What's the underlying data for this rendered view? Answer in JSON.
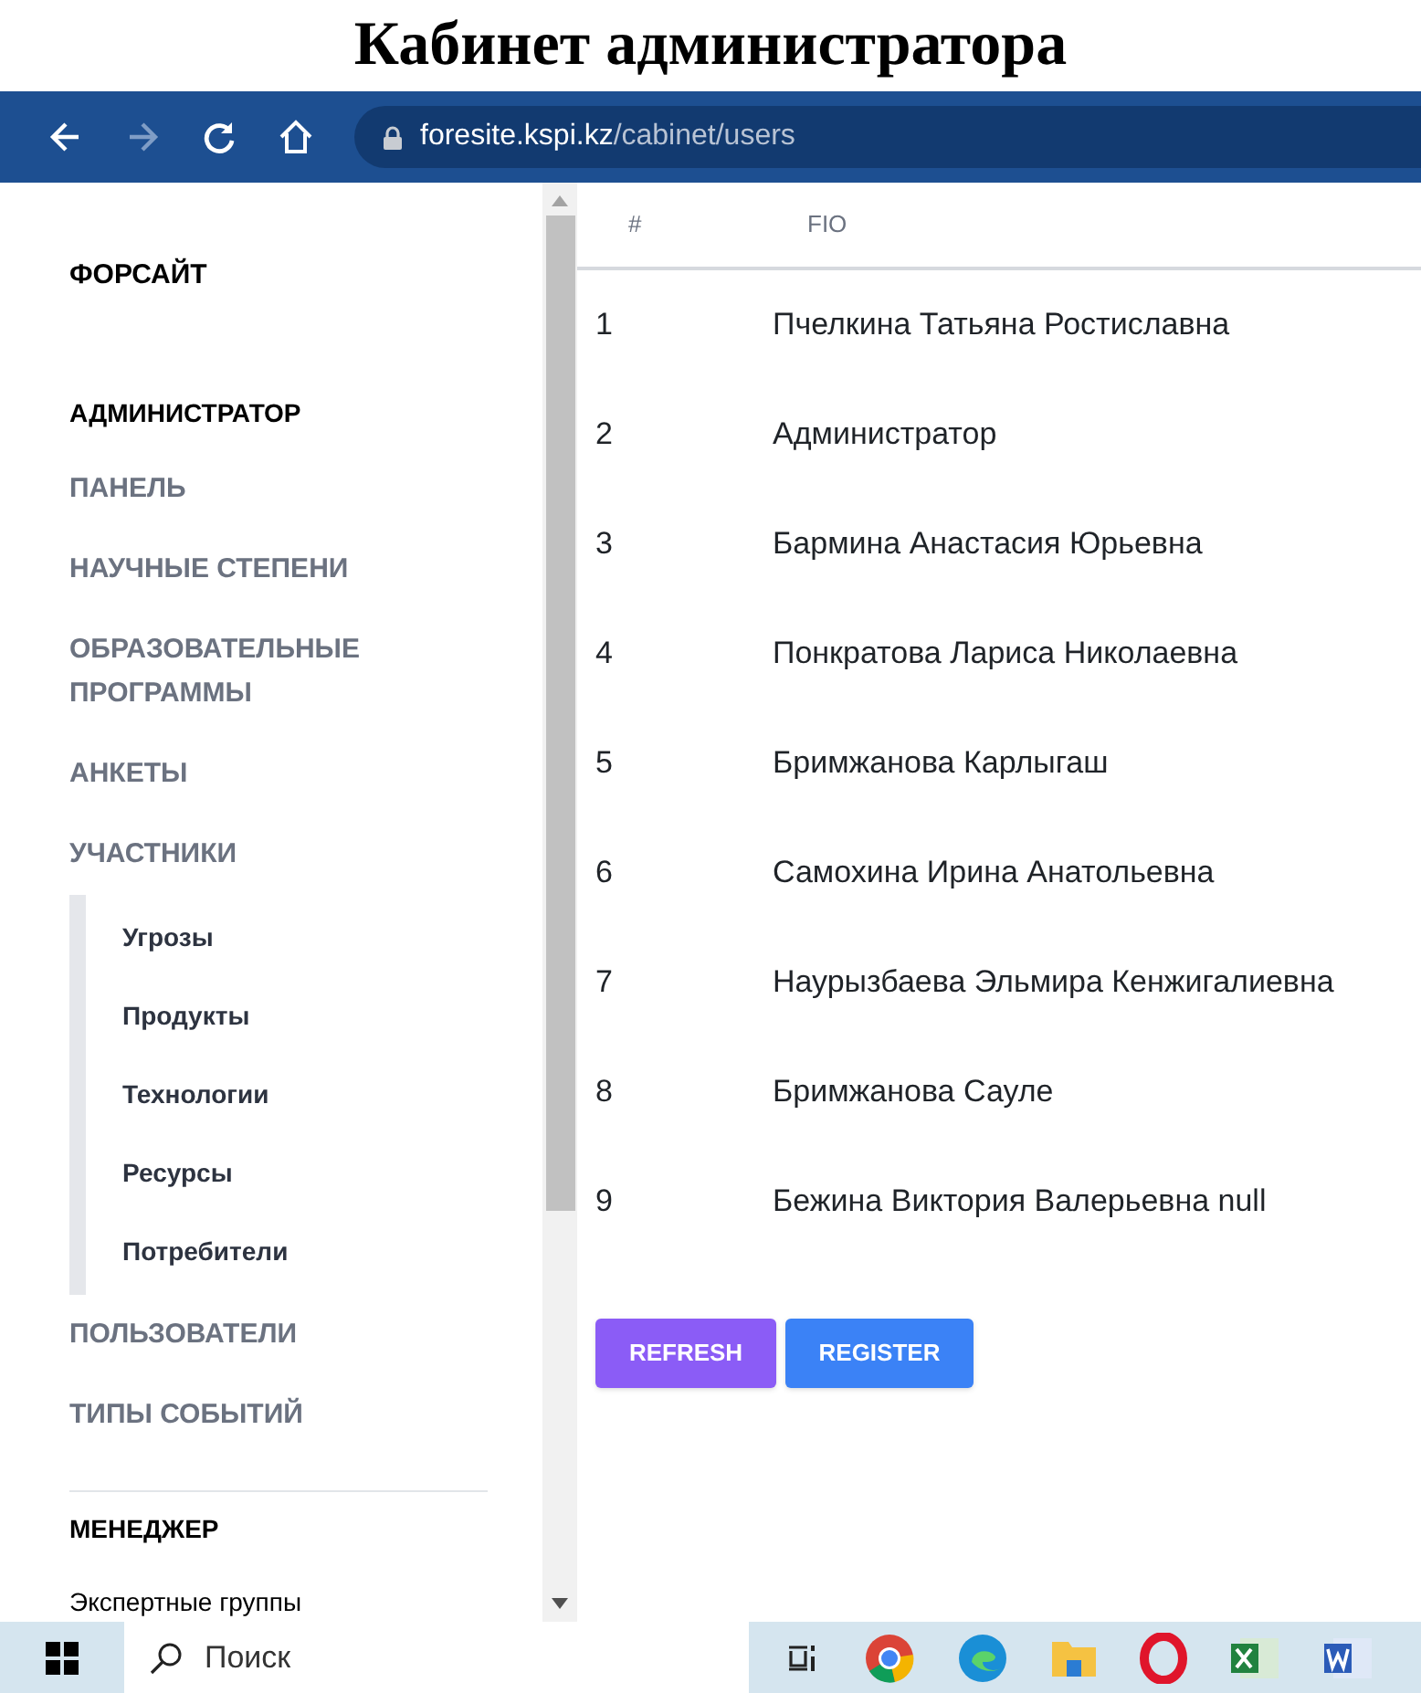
{
  "caption": "Кабинет администратора",
  "browser": {
    "url_host": "foresite.kspi.kz",
    "url_path": "/cabinet/users",
    "forward_disabled": true
  },
  "sidebar": {
    "brand": "ФОРСАЙТ",
    "sections": [
      {
        "title": "АДМИНИСТРАТОР",
        "items": [
          {
            "label": "ПАНЕЛЬ"
          },
          {
            "label": "НАУЧНЫЕ СТЕПЕНИ"
          },
          {
            "label": "ОБРАЗОВАТЕЛЬНЫЕ ПРОГРАММЫ"
          },
          {
            "label": "АНКЕТЫ"
          },
          {
            "label": "УЧАСТНИКИ",
            "expanded": true,
            "children": [
              {
                "label": "Угрозы"
              },
              {
                "label": "Продукты"
              },
              {
                "label": "Технологии"
              },
              {
                "label": "Ресурсы"
              },
              {
                "label": "Потребители"
              }
            ]
          },
          {
            "label": "ПОЛЬЗОВАТЕЛИ"
          },
          {
            "label": "ТИПЫ СОБЫТИЙ"
          }
        ]
      },
      {
        "title": "МЕНЕДЖЕР",
        "items": [
          {
            "label": "Экспертные группы",
            "kind": "plain"
          }
        ]
      }
    ]
  },
  "table": {
    "columns": [
      "#",
      "FIO"
    ],
    "rows": [
      [
        "1",
        "Пчелкина Татьяна Ростиславна"
      ],
      [
        "2",
        "Администратор"
      ],
      [
        "3",
        "Бармина Анастасия Юрьевна"
      ],
      [
        "4",
        "Понкратова Лариса Николаевна"
      ],
      [
        "5",
        "Бримжанова Карлыгаш"
      ],
      [
        "6",
        "Самохина Ирина Анатольевна"
      ],
      [
        "7",
        "Наурызбаева Эльмира Кенжигалиевна"
      ],
      [
        "8",
        "Бримжанова Сауле"
      ],
      [
        "9",
        "Бежина Виктория Валерьевна null"
      ]
    ]
  },
  "buttons": [
    {
      "label": "REFRESH",
      "kind": "secondary"
    },
    {
      "label": "REGISTER",
      "kind": "primary"
    }
  ],
  "taskbar": {
    "search_placeholder": "Поиск"
  }
}
